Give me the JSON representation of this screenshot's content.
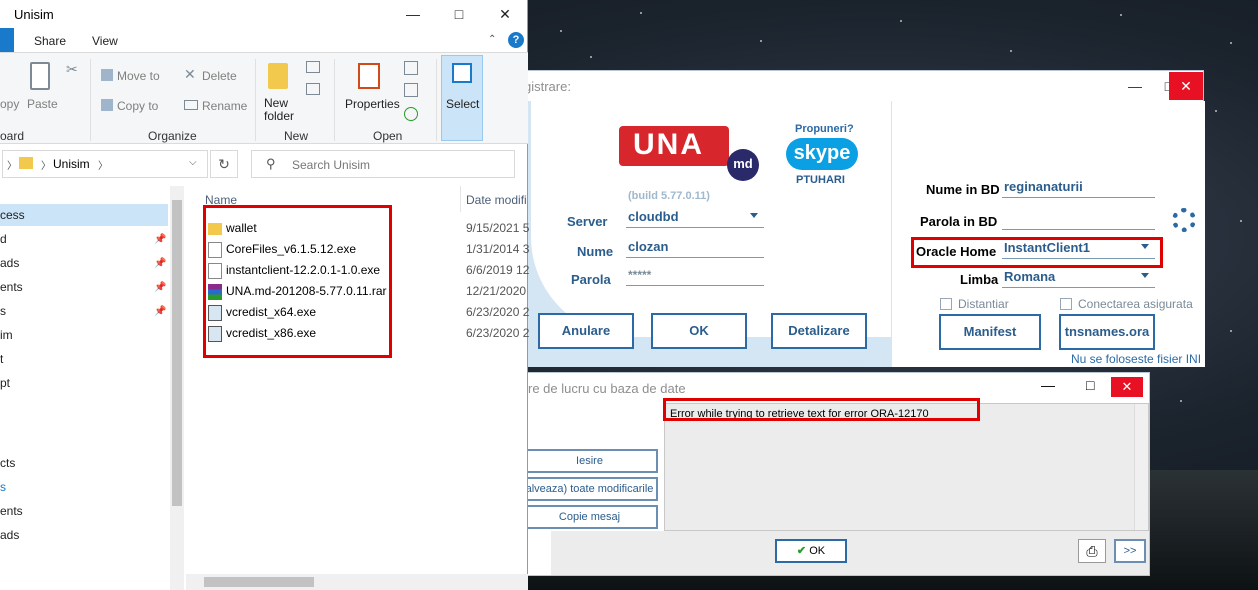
{
  "explorer": {
    "title": "Unisim",
    "tabs": [
      "Share",
      "View"
    ],
    "ribbon": {
      "copy_label": "opy",
      "paste_label": "Paste",
      "clipboard_group": "oard",
      "move_to": "Move to",
      "copy_to": "Copy to",
      "delete": "Delete",
      "rename": "Rename",
      "organize_group": "Organize",
      "new_folder": "New folder",
      "new_group": "New",
      "properties": "Properties",
      "open_group": "Open",
      "select": "Select"
    },
    "address": {
      "path": "Unisim"
    },
    "search": {
      "placeholder": "Search Unisim"
    },
    "columns": {
      "name": "Name",
      "date": "Date modifi"
    },
    "nav_items": [
      "cess",
      "d",
      "ads",
      "ents",
      "s",
      "im",
      "t",
      "pt",
      "cts",
      "s",
      "ents",
      "ads"
    ],
    "files": [
      {
        "name": "wallet",
        "date": "9/15/2021 5",
        "type": "folder"
      },
      {
        "name": "CoreFiles_v6.1.5.12.exe",
        "date": "1/31/2014 3",
        "type": "file"
      },
      {
        "name": "instantclient-12.2.0.1-1.0.exe",
        "date": "6/6/2019 12",
        "type": "file"
      },
      {
        "name": "UNA.md-201208-5.77.0.11.rar",
        "date": "12/21/2020",
        "type": "rar"
      },
      {
        "name": "vcredist_x64.exe",
        "date": "6/23/2020 2",
        "type": "setup"
      },
      {
        "name": "vcredist_x86.exe",
        "date": "6/23/2020 2",
        "type": "setup"
      }
    ]
  },
  "login": {
    "title": "gistrare:",
    "logo_text": "UNA",
    "logo_suffix": "md",
    "propuneri": "Propuneri?",
    "skype": "skype",
    "skype_user": "PTUHARI",
    "build": "(build 5.77.0.11)",
    "server_label": "Server",
    "server_value": "cloudbd",
    "nume_label": "Nume",
    "nume_value": "clozan",
    "parola_label": "Parola",
    "parola_value": "*****",
    "buttons": {
      "anulare": "Anulare",
      "ok": "OK",
      "detalizare": "Detalizare",
      "manifest": "Manifest",
      "tnsnames": "tnsnames.ora"
    },
    "nume_bd_label": "Nume in BD",
    "nume_bd_value": "reginanaturii",
    "parola_bd_label": "Parola in BD",
    "oracle_home_label": "Oracle Home",
    "oracle_home_value": "InstantClient1",
    "limba_label": "Limba",
    "limba_value": "Romana",
    "distantiar": "Distantiar",
    "conectarea": "Conectarea asigurata",
    "nu_se": "Nu se foloseste fisier INI"
  },
  "error_dialog": {
    "title": "re de lucru cu baza de date",
    "message": "Error while trying to retrieve text for error ORA-12170",
    "buttons": {
      "iesire": "Iesire",
      "salveaza": "alveaza) toate modificarile",
      "copie": "Copie mesaj",
      "ok": "OK",
      "next": ">>"
    }
  }
}
